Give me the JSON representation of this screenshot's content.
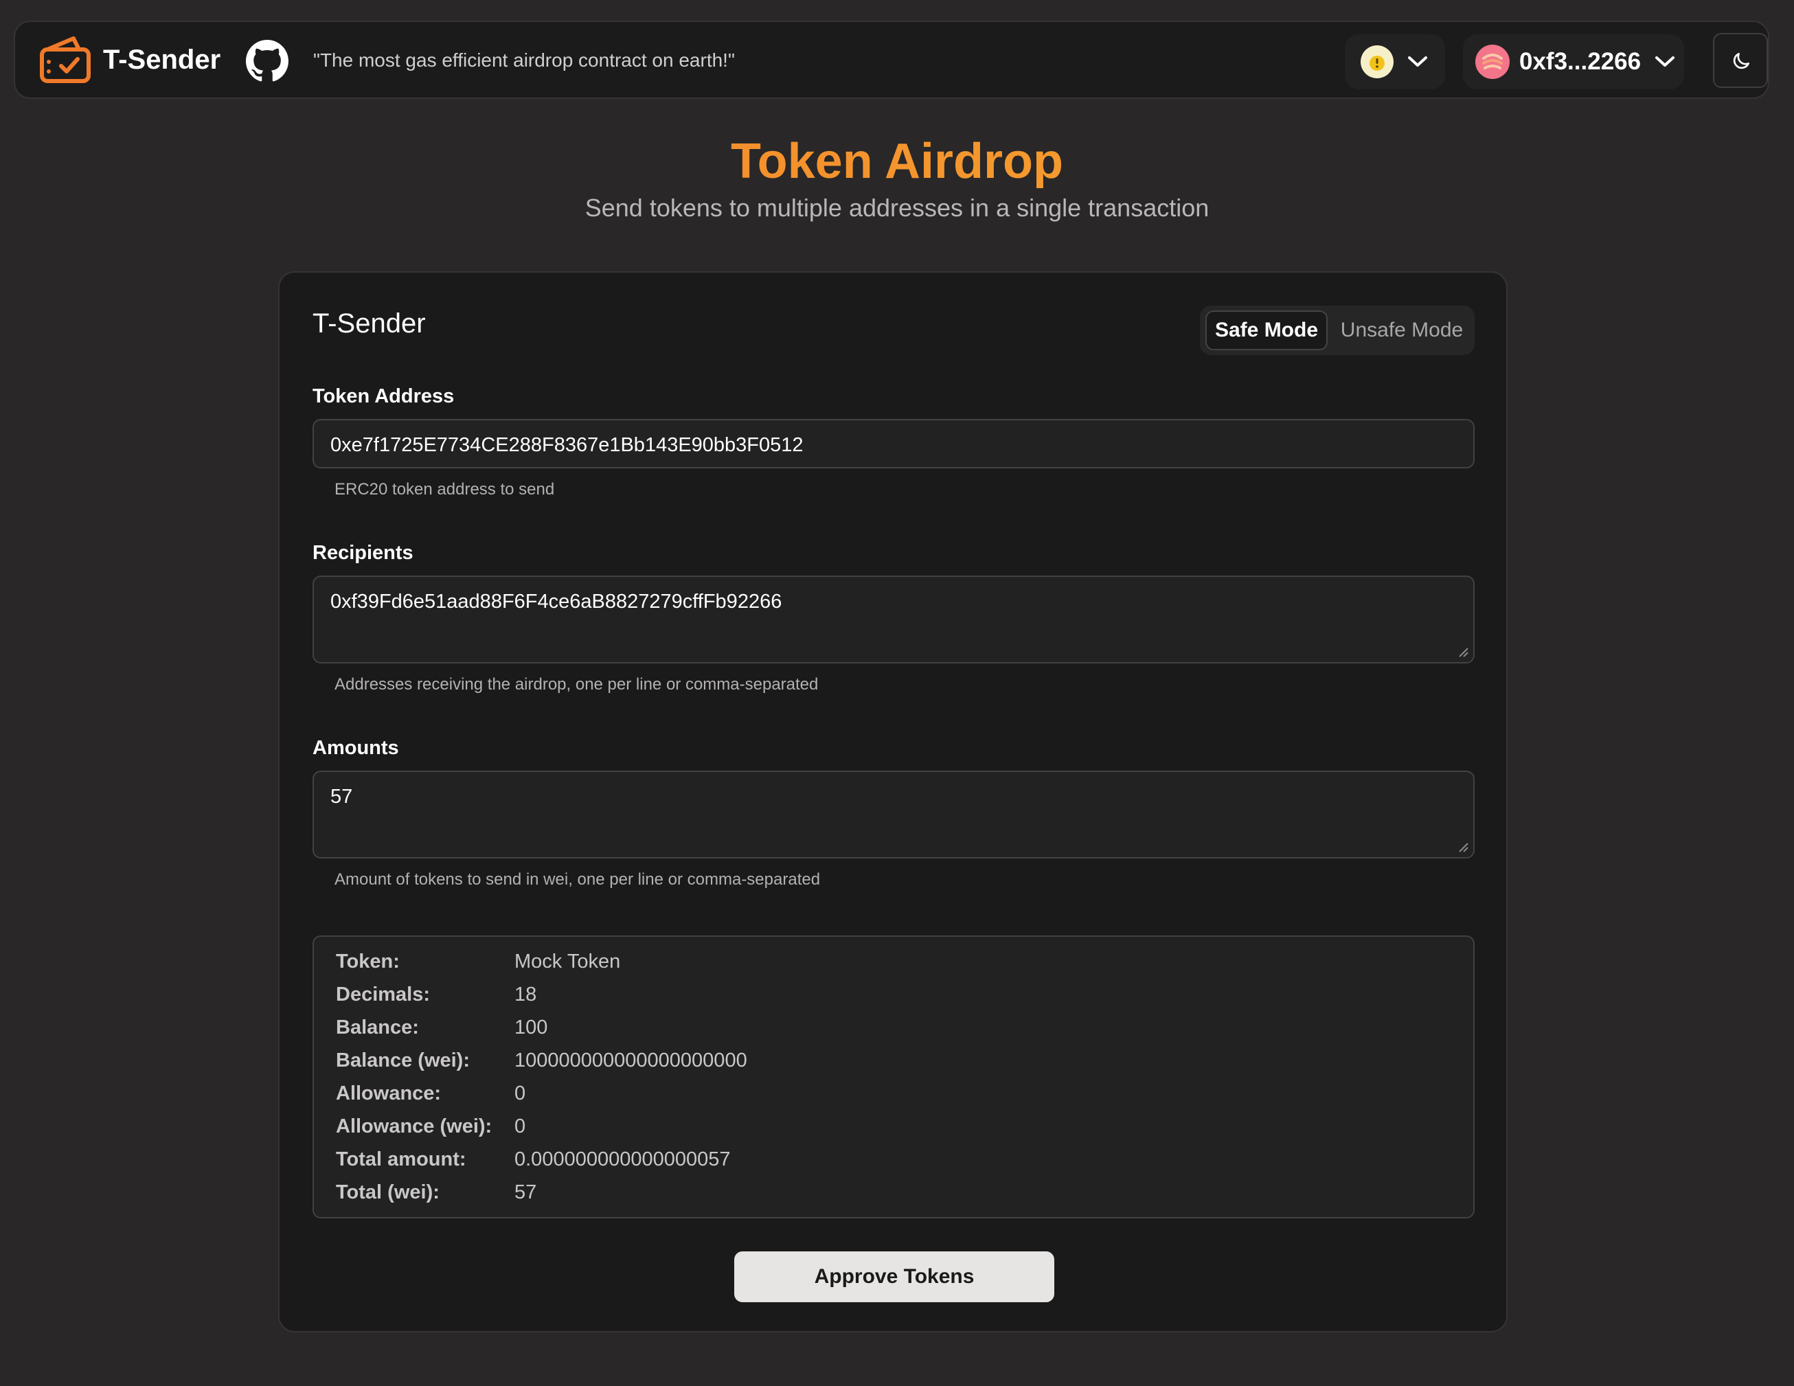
{
  "header": {
    "brand": "T-Sender",
    "tagline": "\"The most gas efficient airdrop contract on earth!\"",
    "account_label": "0xf3...2266"
  },
  "hero": {
    "title": "Token Airdrop",
    "subtitle": "Send tokens to multiple addresses in a single transaction"
  },
  "form": {
    "card_title": "T-Sender",
    "mode": {
      "safe_label": "Safe Mode",
      "unsafe_label": "Unsafe Mode",
      "selected": "Safe Mode"
    },
    "token_address": {
      "label": "Token Address",
      "value": "0xe7f1725E7734CE288F8367e1Bb143E90bb3F0512",
      "helper": "ERC20 token address to send"
    },
    "recipients": {
      "label": "Recipients",
      "value": "0xf39Fd6e51aad88F6F4ce6aB8827279cffFb92266",
      "helper": "Addresses receiving the airdrop, one per line or comma-separated"
    },
    "amounts": {
      "label": "Amounts",
      "value": "57",
      "helper": "Amount of tokens to send in wei, one per line or comma-separated"
    }
  },
  "details": [
    {
      "key": "Token:",
      "value": "Mock Token"
    },
    {
      "key": "Decimals:",
      "value": "18"
    },
    {
      "key": "Balance:",
      "value": "100"
    },
    {
      "key": "Balance (wei):",
      "value": "100000000000000000000"
    },
    {
      "key": "Allowance:",
      "value": "0"
    },
    {
      "key": "Allowance (wei):",
      "value": "0"
    },
    {
      "key": "Total amount:",
      "value": "0.000000000000000057"
    },
    {
      "key": "Total (wei):",
      "value": "57"
    }
  ],
  "actions": {
    "approve_label": "Approve Tokens"
  },
  "icons": {
    "logo": "wallet-logo-icon",
    "github": "github-icon",
    "chain": "chain-warning-icon",
    "account_avatar": "account-avatar-icon",
    "theme": "moon-icon"
  },
  "colors": {
    "background": "#292727",
    "card": "#1b1a1a",
    "accent_orange": "#f07a2a",
    "accent_yellow": "#f7c13a",
    "button": "#e6e5e3"
  }
}
